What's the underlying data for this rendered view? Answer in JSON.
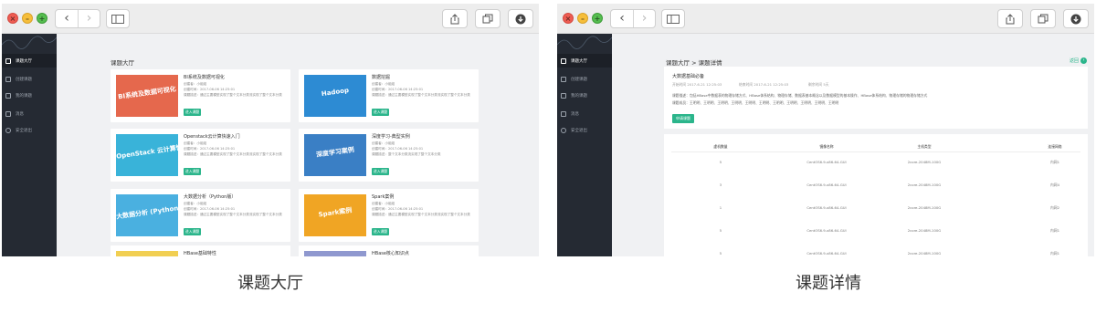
{
  "left_window": {
    "sidebar": {
      "items": [
        {
          "label": "课题大厅",
          "active": true
        },
        {
          "label": "创建课题",
          "active": false
        },
        {
          "label": "我的课题",
          "active": false
        },
        {
          "label": "消息",
          "active": false
        },
        {
          "label": "安全退出",
          "active": false
        }
      ]
    },
    "page_title": "课题大厅",
    "cards": [
      {
        "title": "BI系统及数据可视化",
        "thumb_text": "BI系统及数据可视化",
        "thumb_color": "#e5684d",
        "creator": "创建者：小组组",
        "created": "创建时间：2017-06-06 14:25:01",
        "desc": "课题描述：通过主要模型实现了整个文本分类流实现了整个文本分类",
        "button": "进入课题"
      },
      {
        "title": "数据挖掘",
        "thumb_text": "Hadoop",
        "thumb_color": "#2d8bd3",
        "creator": "创建者：小组组",
        "created": "创建时间：2017-06-06 14:25:01",
        "desc": "课题描述：通过主要模型实现了整个文本分类流实现了整个文本分类",
        "button": "进入课题"
      },
      {
        "title": "Openstack云计算快速入门",
        "thumb_text": "OpenStack 云计算快速入门",
        "thumb_color": "#39b3d9",
        "creator": "创建者：小组组",
        "created": "创建时间：2017-06-06 14:25:01",
        "desc": "课题描述：通过主要模型实现了整个文本分类流实现了整个文本分类",
        "button": "进入课题"
      },
      {
        "title": "深度学习-典型实例",
        "thumb_text": "深度学习案例",
        "thumb_color": "#3a7fc5",
        "creator": "创建者：小组组",
        "created": "创建时间：2017-06-06 14:25:01",
        "desc": "课题描述：整个文本分类流实现了整个文本分类",
        "button": "进入课题"
      },
      {
        "title": "大数据分析（Python版）",
        "thumb_text": "大数据分析 (Python版)",
        "thumb_color": "#4ab0e0",
        "creator": "创建者：小组组",
        "created": "创建时间：2017-06-06 14:25:01",
        "desc": "课题描述：通过主要模型实现了整个文本分类流实现了整个文本分类",
        "button": "进入课题"
      },
      {
        "title": "Spark案例",
        "thumb_text": "Spark案例",
        "thumb_color": "#f0a524",
        "creator": "创建者：小组组",
        "created": "创建时间：2017-06-06 14:25:01",
        "desc": "课题描述：通过主要模型实现了整个文本分类流实现了整个文本分类",
        "button": "进入课题"
      },
      {
        "title": "HBase基础特性",
        "thumb_text": "",
        "thumb_color": "#f1cf52"
      },
      {
        "title": "HBase核心知识点",
        "thumb_text": "",
        "thumb_color": "#8f98cf"
      }
    ]
  },
  "right_window": {
    "sidebar": {
      "items": [
        {
          "label": "课题大厅",
          "active": true
        },
        {
          "label": "创建课题",
          "active": false
        },
        {
          "label": "我的课题",
          "active": false
        },
        {
          "label": "消息",
          "active": false
        },
        {
          "label": "安全退出",
          "active": false
        }
      ]
    },
    "breadcrumb": "课题大厅 > 课题详情",
    "back_label": "返回",
    "info": {
      "title": "大数据基础必备",
      "start": "开始时间 2017-6-21 12:25:03",
      "end": "结束时间 2017-6-21 12:25:03",
      "duration": "剩余时间 5天",
      "desc": "课题描述：包括HBase中数据表的物理存储方式、HBase体系结构、物理存储、数据表基本概念以及数据模型的基本操作、HBase体系结构、物理存储的物理存储方式",
      "members": "课题成员：王明明、王明明、王明明、王明明、王明明、王明明、王明明、王明明、王明明、王明明、王明明",
      "apply_button": "申请课题"
    },
    "table": {
      "headers": [
        "虚机数量",
        "镜像名称",
        "主机类型",
        "连接网络"
      ],
      "rows": [
        [
          "5",
          "CentOS6.9-x86-64-GUI",
          "2core-2048M-100G",
          "内网1"
        ],
        [
          "3",
          "CentOS6.9-x86-64-GUI",
          "2core-2048M-100G",
          "内网4"
        ],
        [
          "1",
          "CentOS6.9-x86-64-GUI",
          "2core-2048M-100G",
          "内网2"
        ],
        [
          "5",
          "CentOS6.9-x86-64-GUI",
          "2core-2048M-100G",
          "内网1"
        ],
        [
          "5",
          "CentOS6.9-x86-64-GUI",
          "2core-2048M-100G",
          "内网1"
        ]
      ]
    }
  },
  "captions": {
    "left": "课题大厅",
    "right": "课题详情"
  },
  "colors": {
    "sidebar_bg": "#252a33",
    "accent": "#2bb58b",
    "page_bg": "#f0f1f3"
  },
  "icons": [
    "close-icon",
    "minimize-icon",
    "maximize-icon",
    "chevron-left-icon",
    "chevron-right-icon",
    "sidebar-icon",
    "share-icon",
    "tabs-icon",
    "download-icon"
  ]
}
